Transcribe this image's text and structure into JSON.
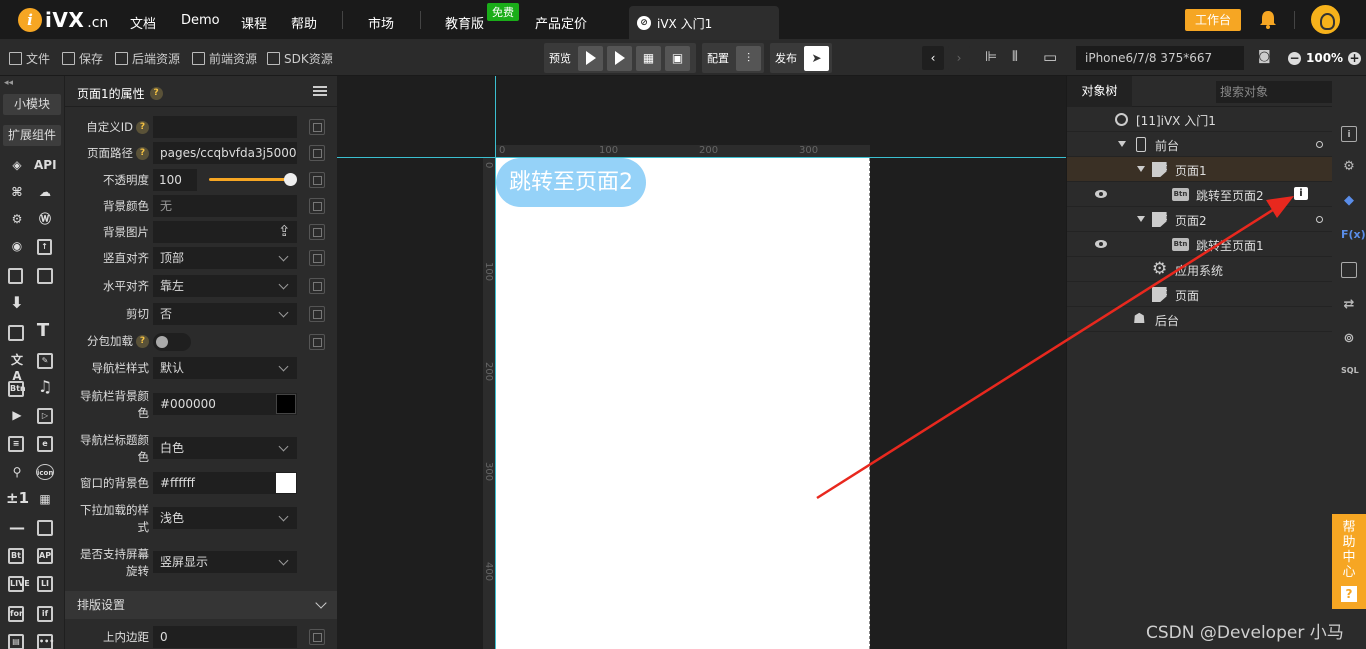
{
  "topnav": {
    "logo_text": "iVX",
    "logo_cn": ".cn",
    "items": [
      "文档",
      "Demo",
      "课程",
      "帮助",
      "市场",
      "教育版",
      "产品定价"
    ],
    "free_badge": "免费",
    "app_tab": "iVX 入门1",
    "workbench": "工作台"
  },
  "toolbar": {
    "file": "文件",
    "save": "保存",
    "backend": "后端资源",
    "frontend": "前端资源",
    "sdk": "SDK资源",
    "preview": "预览",
    "config": "配置",
    "publish": "发布",
    "device": "iPhone6/7/8 375*667",
    "zoom": "100%"
  },
  "rail": {
    "chip1": "小模块",
    "chip2": "扩展组件",
    "api": "API"
  },
  "props": {
    "title": "页面1的属性",
    "custom_id_label": "自定义ID",
    "custom_id_value": "",
    "page_path_label": "页面路径",
    "page_path_value": "pages/ccqbvfda3j50000",
    "opacity_label": "不透明度",
    "opacity_value": "100 %",
    "bg_color_label": "背景颜色",
    "bg_color_value": "无",
    "bg_image_label": "背景图片",
    "valign_label": "竖直对齐",
    "valign_value": "顶部",
    "halign_label": "水平对齐",
    "halign_value": "靠左",
    "clip_label": "剪切",
    "clip_value": "否",
    "subpkg_label": "分包加载",
    "navstyle_label": "导航栏样式",
    "navstyle_value": "默认",
    "navbg_label": "导航栏背景颜色",
    "navbg_value": "#000000",
    "navbg_swatch": "#000000",
    "navtitle_label": "导航栏标题颜色",
    "navtitle_value": "白色",
    "winbg_label": "窗口的背景色",
    "winbg_value": "#ffffff",
    "winbg_swatch": "#ffffff",
    "pull_label": "下拉加载的样式",
    "pull_value": "浅色",
    "rotate_label": "是否支持屏幕旋转",
    "rotate_value": "竖屏显示",
    "layout_section": "排版设置",
    "padding_top_label": "上内边距",
    "padding_top_value": "0"
  },
  "canvas": {
    "ruler_top": [
      "0",
      "100",
      "200",
      "300"
    ],
    "ruler_left": [
      "0",
      "100",
      "200",
      "300",
      "400"
    ],
    "jump_button": "跳转至页面2"
  },
  "tree": {
    "tab": "对象树",
    "search_placeholder": "搜索对象",
    "nodes": {
      "root": "[11]iVX 入门1",
      "front": "前台",
      "page1": "页面1",
      "btn1": "跳转至页面2",
      "page2": "页面2",
      "btn2": "跳转至页面1",
      "appsys": "应用系统",
      "page": "页面",
      "backend": "后台"
    }
  },
  "help": {
    "label": "帮助中心",
    "q": "?"
  },
  "watermark": "CSDN @Developer 小马",
  "colors": {
    "accent": "#f6a623",
    "guide": "#3bbfd0",
    "button_bg": "#95d2f8",
    "arrow": "#e8281e"
  }
}
